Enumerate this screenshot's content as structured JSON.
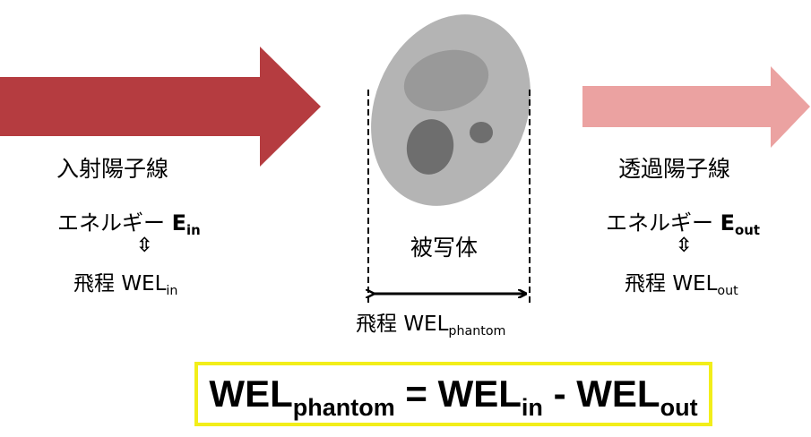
{
  "incoming": {
    "label": "入射陽子線",
    "energy_label": "エネルギー",
    "energy_symbol": "E",
    "energy_sub": "in",
    "equiv_symbol": "⇳",
    "range_label": "飛程",
    "wel_symbol": "WEL",
    "wel_sub": "in"
  },
  "outgoing": {
    "label": "透過陽子線",
    "energy_label": "エネルギー",
    "energy_symbol": "E",
    "energy_sub": "out",
    "equiv_symbol": "⇳",
    "range_label": "飛程",
    "wel_symbol": "WEL",
    "wel_sub": "out"
  },
  "phantom": {
    "label": "被写体",
    "range_label": "飛程",
    "wel_symbol": "WEL",
    "wel_sub": "phantom"
  },
  "formula": {
    "lhs": "WEL",
    "lhs_sub": "phantom",
    "equals": "=",
    "term1": "WEL",
    "term1_sub": "in",
    "minus": "-",
    "term2": "WEL",
    "term2_sub": "out"
  },
  "colors": {
    "incoming_arrow": "#b53c40",
    "outgoing_arrow": "#eba2a1",
    "phantom_body": "#b4b4b4",
    "phantom_insert_light": "#999999",
    "phantom_insert_dark": "#6e6e6e",
    "formula_border": "#f2ee1a"
  }
}
